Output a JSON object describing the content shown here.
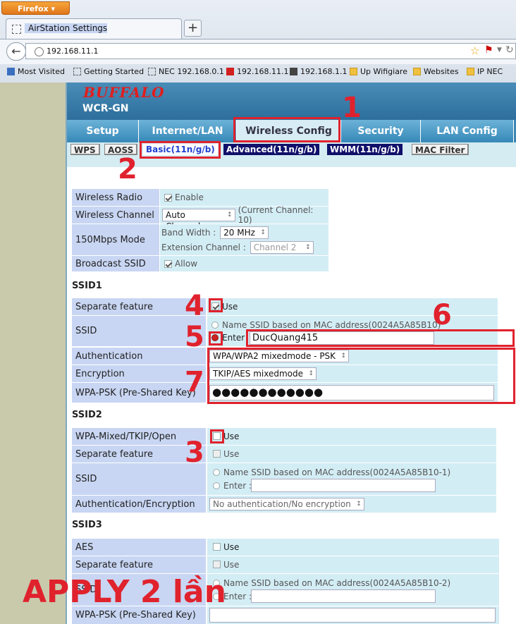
{
  "browser": {
    "app_button": "Firefox",
    "tab_title": "AirStation Settings",
    "new_tab": "+",
    "url": "192.168.11.1",
    "bookmarks": [
      "Most Visited",
      "Getting Started",
      "NEC 192.168.0.1",
      "192.168.11.1",
      "192.168.1.1",
      "Up Wifigiare",
      "Websites",
      "IP NEC"
    ]
  },
  "router": {
    "brand": "BUFFALO",
    "model": "WCR-GN",
    "menu": [
      "Setup",
      "Internet/LAN",
      "Wireless Config",
      "Security",
      "LAN Config"
    ],
    "active_menu": "Wireless Config",
    "submenu": [
      "WPS",
      "AOSS",
      "Basic(11n/g/b)",
      "Advanced(11n/g/b)",
      "WMM(11n/g/b)",
      "MAC Filter"
    ],
    "active_submenu": "Basic(11n/g/b)"
  },
  "general": {
    "wireless_radio_label": "Wireless Radio",
    "wireless_radio_option": "Enable",
    "wireless_radio_checked": true,
    "wireless_channel_label": "Wireless Channel",
    "wireless_channel_value": "Auto Channel",
    "current_channel": "(Current Channel: 10)",
    "mode_label": "150Mbps Mode",
    "band_width_label": "Band Width :",
    "band_width_value": "20 MHz",
    "extension_channel_label": "Extension Channel :",
    "extension_channel_value": "Channel 2",
    "broadcast_label": "Broadcast SSID",
    "broadcast_option": "Allow",
    "broadcast_checked": true
  },
  "ssid1": {
    "title": "SSID1",
    "separate_label": "Separate feature",
    "separate_option": "Use",
    "separate_checked": true,
    "ssid_label": "SSID",
    "mac_option": "Name SSID based on MAC address(0024A5A85B10)",
    "enter_option": "Enter",
    "ssid_value": "DucQuang415",
    "auth_label": "Authentication",
    "auth_value": "WPA/WPA2 mixedmode - PSK",
    "enc_label": "Encryption",
    "enc_value": "TKIP/AES mixedmode",
    "psk_label": "WPA-PSK (Pre-Shared Key)",
    "psk_value": "●●●●●●●●●●●●"
  },
  "ssid2": {
    "title": "SSID2",
    "mode_label": "WPA-Mixed/TKIP/Open",
    "mode_option": "Use",
    "separate_label": "Separate feature",
    "separate_option": "Use",
    "ssid_label": "SSID",
    "mac_option": "Name SSID based on MAC address(0024A5A85B10-1)",
    "enter_option": "Enter :",
    "authenc_label": "Authentication/Encryption",
    "authenc_value": "No authentication/No encryption"
  },
  "ssid3": {
    "title": "SSID3",
    "aes_label": "AES",
    "aes_option": "Use",
    "separate_label": "Separate feature",
    "separate_option": "Use",
    "ssid_label": "SSID",
    "mac_option": "Name SSID based on MAC address(0024A5A85B10-2)",
    "enter_option": "Enter :",
    "psk_label": "WPA-PSK (Pre-Shared Key)"
  },
  "annotations": {
    "numbers": [
      "1",
      "2",
      "3",
      "4",
      "5",
      "6",
      "7"
    ],
    "apply_note": "APPLY 2 lần",
    "color": "#e0222d"
  }
}
